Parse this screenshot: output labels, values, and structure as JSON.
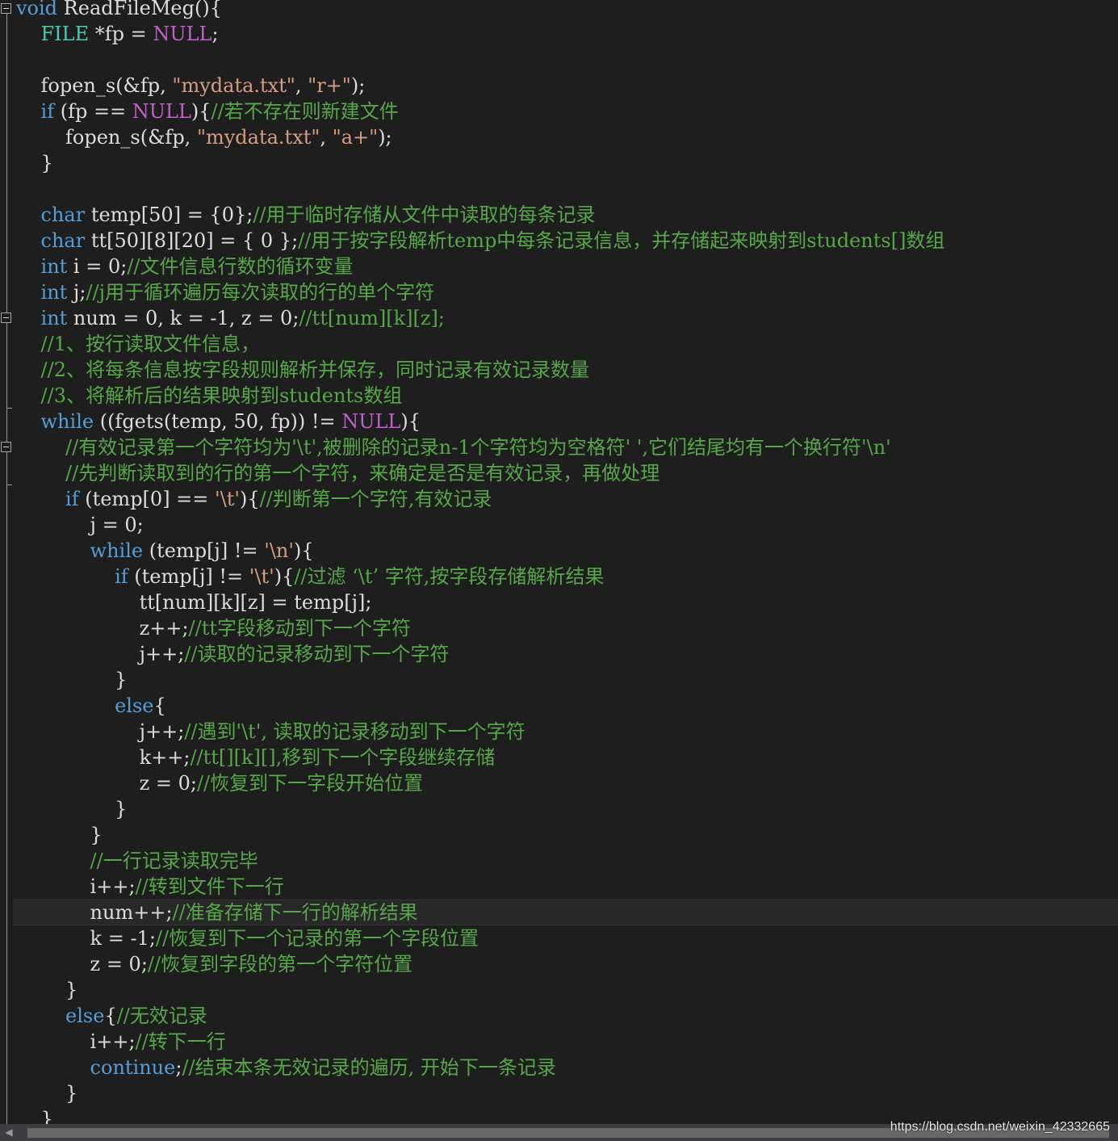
{
  "editor": {
    "lines": [
      [
        [
          "kw",
          "void"
        ],
        [
          "pl",
          " ReadFileMeg(){"
        ]
      ],
      [
        [
          "pl",
          "    "
        ],
        [
          "ty",
          "FILE"
        ],
        [
          "pl",
          " *fp = "
        ],
        [
          "mac",
          "NULL"
        ],
        [
          "pl",
          ";"
        ]
      ],
      [],
      [
        [
          "pl",
          "    fopen_s(&fp, "
        ],
        [
          "str",
          "\"mydata.txt\""
        ],
        [
          "pl",
          ", "
        ],
        [
          "str",
          "\"r+\""
        ],
        [
          "pl",
          ");"
        ]
      ],
      [
        [
          "pl",
          "    "
        ],
        [
          "kw",
          "if"
        ],
        [
          "pl",
          " (fp == "
        ],
        [
          "mac",
          "NULL"
        ],
        [
          "pl",
          "){"
        ],
        [
          "cmt",
          "//若不存在则新建文件"
        ]
      ],
      [
        [
          "pl",
          "        fopen_s(&fp, "
        ],
        [
          "str",
          "\"mydata.txt\""
        ],
        [
          "pl",
          ", "
        ],
        [
          "str",
          "\"a+\""
        ],
        [
          "pl",
          ");"
        ]
      ],
      [
        [
          "pl",
          "    }"
        ]
      ],
      [],
      [
        [
          "pl",
          "    "
        ],
        [
          "kw",
          "char"
        ],
        [
          "pl",
          " temp[50] = {0};"
        ],
        [
          "cmt",
          "//用于临时存储从文件中读取的每条记录"
        ]
      ],
      [
        [
          "pl",
          "    "
        ],
        [
          "kw",
          "char"
        ],
        [
          "pl",
          " tt[50][8][20] = { 0 };"
        ],
        [
          "cmt",
          "//用于按字段解析temp中每条记录信息，并存储起来映射到students[]数组"
        ]
      ],
      [
        [
          "pl",
          "    "
        ],
        [
          "kw",
          "int"
        ],
        [
          "pl",
          " i = 0;"
        ],
        [
          "cmt",
          "//文件信息行数的循环变量"
        ]
      ],
      [
        [
          "pl",
          "    "
        ],
        [
          "kw",
          "int"
        ],
        [
          "pl",
          " j;"
        ],
        [
          "cmt",
          "//j用于循环遍历每次读取的行的单个字符"
        ]
      ],
      [
        [
          "pl",
          "    "
        ],
        [
          "kw",
          "int"
        ],
        [
          "pl",
          " num = 0, k = -1, z = 0;"
        ],
        [
          "cmt",
          "//tt[num][k][z];"
        ]
      ],
      [
        [
          "pl",
          "    "
        ],
        [
          "cmt",
          "//1、按行读取文件信息，"
        ]
      ],
      [
        [
          "pl",
          "    "
        ],
        [
          "cmt",
          "//2、将每条信息按字段规则解析并保存，同时记录有效记录数量"
        ]
      ],
      [
        [
          "pl",
          "    "
        ],
        [
          "cmt",
          "//3、将解析后的结果映射到students数组"
        ]
      ],
      [
        [
          "pl",
          "    "
        ],
        [
          "kw",
          "while"
        ],
        [
          "pl",
          " ((fgets(temp, 50, fp)) != "
        ],
        [
          "mac",
          "NULL"
        ],
        [
          "pl",
          "){"
        ]
      ],
      [
        [
          "pl",
          "        "
        ],
        [
          "cmt",
          "//有效记录第一个字符均为'\\t',被删除的记录n-1个字符均为空格符' ',它们结尾均有一个换行符'\\n'"
        ]
      ],
      [
        [
          "pl",
          "        "
        ],
        [
          "cmt",
          "//先判断读取到的行的第一个字符，来确定是否是有效记录，再做处理"
        ]
      ],
      [
        [
          "pl",
          "        "
        ],
        [
          "kw",
          "if"
        ],
        [
          "pl",
          " (temp[0] == "
        ],
        [
          "str",
          "'\\t'"
        ],
        [
          "pl",
          "){"
        ],
        [
          "cmt",
          "//判断第一个字符,有效记录"
        ]
      ],
      [
        [
          "pl",
          "            j = 0;"
        ]
      ],
      [
        [
          "pl",
          "            "
        ],
        [
          "kw",
          "while"
        ],
        [
          "pl",
          " (temp[j] != "
        ],
        [
          "str",
          "'\\n'"
        ],
        [
          "pl",
          "){"
        ]
      ],
      [
        [
          "pl",
          "                "
        ],
        [
          "kw",
          "if"
        ],
        [
          "pl",
          " (temp[j] != "
        ],
        [
          "str",
          "'\\t'"
        ],
        [
          "pl",
          "){"
        ],
        [
          "cmt",
          "//过滤 ‘\\t’ 字符,按字段存储解析结果"
        ]
      ],
      [
        [
          "pl",
          "                    tt[num][k][z] = temp[j];"
        ]
      ],
      [
        [
          "pl",
          "                    z++;"
        ],
        [
          "cmt",
          "//tt字段移动到下一个字符"
        ]
      ],
      [
        [
          "pl",
          "                    j++;"
        ],
        [
          "cmt",
          "//读取的记录移动到下一个字符"
        ]
      ],
      [
        [
          "pl",
          "                }"
        ]
      ],
      [
        [
          "pl",
          "                "
        ],
        [
          "kw",
          "else"
        ],
        [
          "pl",
          "{"
        ]
      ],
      [
        [
          "pl",
          "                    j++;"
        ],
        [
          "cmt",
          "//遇到'\\t', 读取的记录移动到下一个字符"
        ]
      ],
      [
        [
          "pl",
          "                    k++;"
        ],
        [
          "cmt",
          "//tt[][k][],移到下一个字段继续存储"
        ]
      ],
      [
        [
          "pl",
          "                    z = 0;"
        ],
        [
          "cmt",
          "//恢复到下一字段开始位置"
        ]
      ],
      [
        [
          "pl",
          "                }"
        ]
      ],
      [
        [
          "pl",
          "            }"
        ]
      ],
      [
        [
          "pl",
          "            "
        ],
        [
          "cmt",
          "//一行记录读取完毕"
        ]
      ],
      [
        [
          "pl",
          "            i++;"
        ],
        [
          "cmt",
          "//转到文件下一行"
        ]
      ],
      [
        [
          "pl",
          "            num++;"
        ],
        [
          "cmt",
          "//准备存储下一行的解析结果"
        ]
      ],
      [
        [
          "pl",
          "            k = -1;"
        ],
        [
          "cmt",
          "//恢复到下一个记录的第一个字段位置"
        ]
      ],
      [
        [
          "pl",
          "            z = 0;"
        ],
        [
          "cmt",
          "//恢复到字段的第一个字符位置"
        ]
      ],
      [
        [
          "pl",
          "        }"
        ]
      ],
      [
        [
          "pl",
          "        "
        ],
        [
          "kw",
          "else"
        ],
        [
          "pl",
          "{"
        ],
        [
          "cmt",
          "//无效记录"
        ]
      ],
      [
        [
          "pl",
          "            i++;"
        ],
        [
          "cmt",
          "//转下一行"
        ]
      ],
      [
        [
          "pl",
          "            "
        ],
        [
          "kw",
          "continue"
        ],
        [
          "pl",
          ";"
        ],
        [
          "cmt",
          "//结束本条无效记录的遍历, 开始下一条记录"
        ]
      ],
      [
        [
          "pl",
          "        }"
        ]
      ],
      [
        [
          "pl",
          "    }"
        ]
      ]
    ],
    "current_line_index": 35
  },
  "scrollbar": {
    "left_arrow_icon": "◀"
  },
  "watermark": "https://blog.csdn.net/weixin_42332665",
  "colors": {
    "background": "#1e1e1e",
    "keyword": "#569cd6",
    "type": "#4ec9b0",
    "macro": "#bd63c5",
    "string": "#d69d85",
    "comment": "#57a64a",
    "plain": "#dcdcdc"
  }
}
